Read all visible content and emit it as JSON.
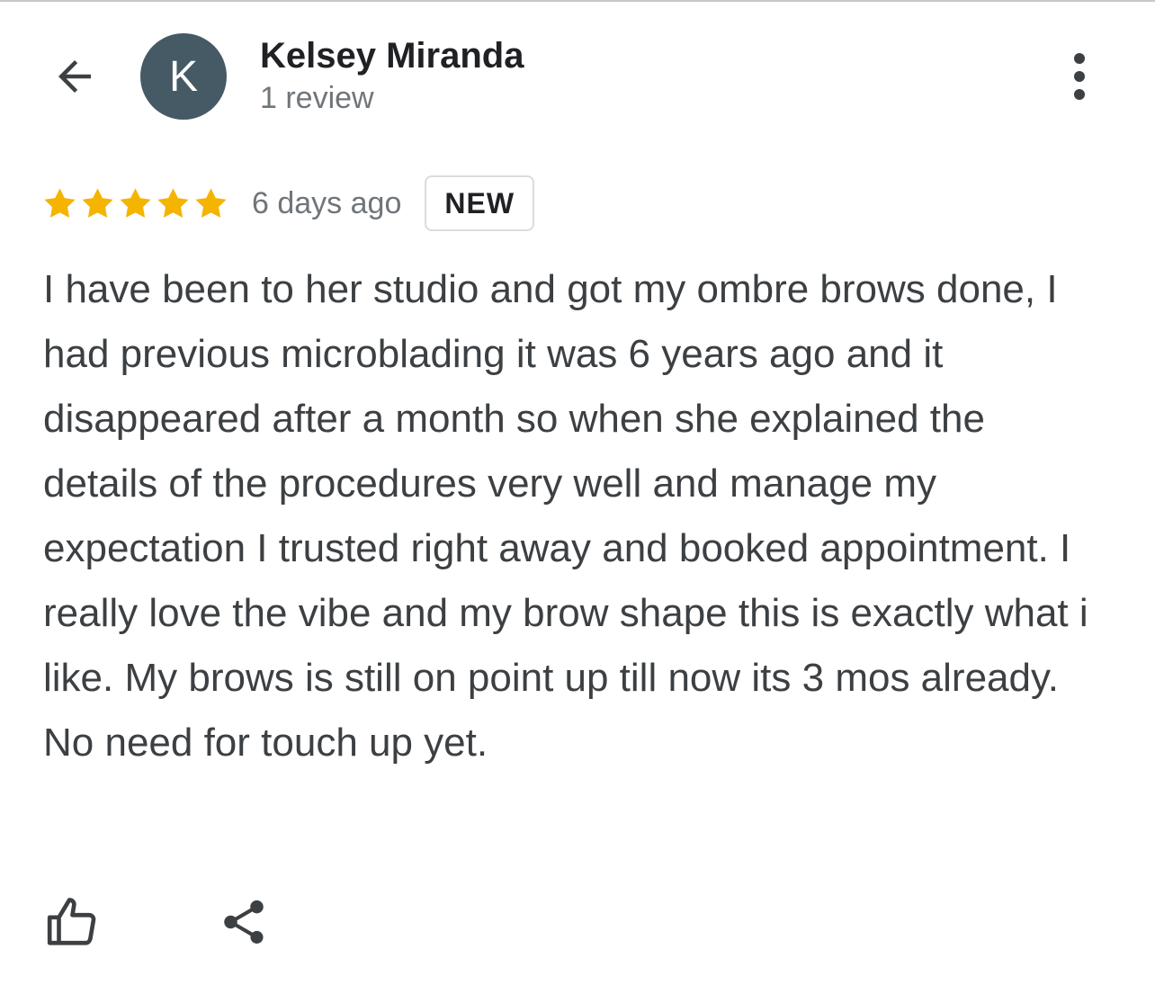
{
  "header": {
    "back_icon": "arrow-back-icon",
    "avatar_initial": "K",
    "avatar_color": "#455a64",
    "author_name": "Kelsey Miranda",
    "review_count": "1 review",
    "more_icon": "more-vert-icon"
  },
  "review": {
    "rating": 5,
    "rating_max": 5,
    "star_color": "#f4b400",
    "time_ago": "6 days ago",
    "badge": "NEW",
    "text": "I have been to her studio and got my ombre brows done, I had previous microblading it was 6 years ago and it disappeared after a month so when she explained the details of the procedures very well and manage my expectation I trusted right away and booked appointment. I really love the vibe and my brow shape this is exactly what i like. My brows is still on point up till now its 3 mos already. No need for touch up yet."
  },
  "actions": {
    "like_icon": "thumb-up-icon",
    "share_icon": "share-icon"
  }
}
